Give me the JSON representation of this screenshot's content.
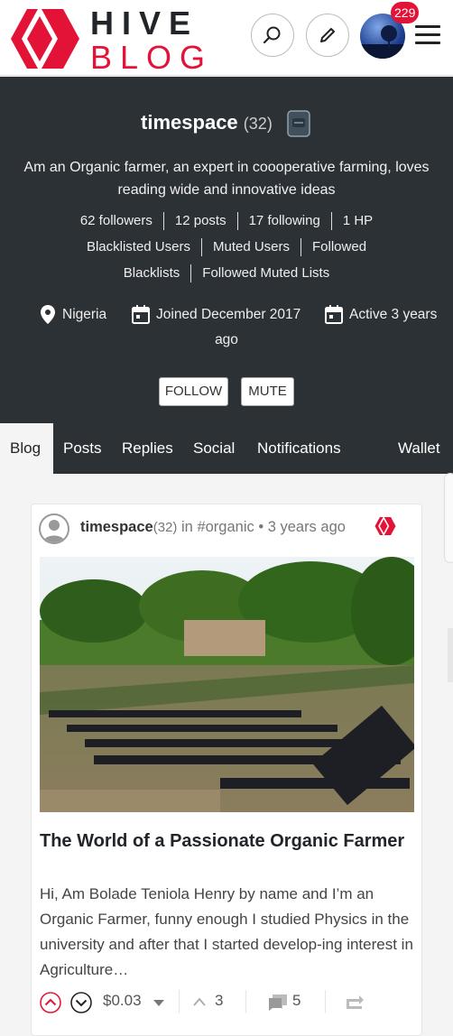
{
  "header": {
    "logo_line1": "HIVE",
    "logo_line2": "BLOG",
    "search_icon": "search-icon",
    "write_icon": "pencil-icon",
    "notification_count": "229",
    "menu_icon": "hamburger-icon",
    "brand_color": "#e31337"
  },
  "profile": {
    "name": "timespace",
    "reputation": "(32)",
    "about": "Am an Organic farmer, an expert in coooperative farming, loves reading wide and innovative ideas",
    "followers": "62 followers",
    "posts": "12 posts",
    "following": "17 following",
    "hp": "1 HP",
    "blacklisted_users": "Blacklisted Users",
    "muted_users": "Muted Users",
    "followed": "Followed",
    "blacklists": "Blacklists",
    "followed_muted_lists": "Followed Muted Lists",
    "location": "Nigeria",
    "joined": "Joined December 2017",
    "active_line1": "Active 3 years",
    "active_line2": "ago",
    "follow_button": "FOLLOW",
    "mute_button": "MUTE"
  },
  "tabs": {
    "blog": "Blog",
    "posts": "Posts",
    "replies": "Replies",
    "social": "Social",
    "notifications": "Notifications",
    "wallet": "Wallet"
  },
  "post": {
    "author": "timespace",
    "author_rep": "(32)",
    "in_text": "in",
    "community": "#organic",
    "dot": "•",
    "time": "3 years ago",
    "title": "The World of a Passionate Organic Farmer",
    "excerpt": "Hi, Am Bolade Teniola Henry by name and I’m an Organic Farmer, funny enough I studied Physics in the university and after that I started develop-ing interest in Agriculture…",
    "payout": "$0.03",
    "votes": "3",
    "comments": "5"
  }
}
